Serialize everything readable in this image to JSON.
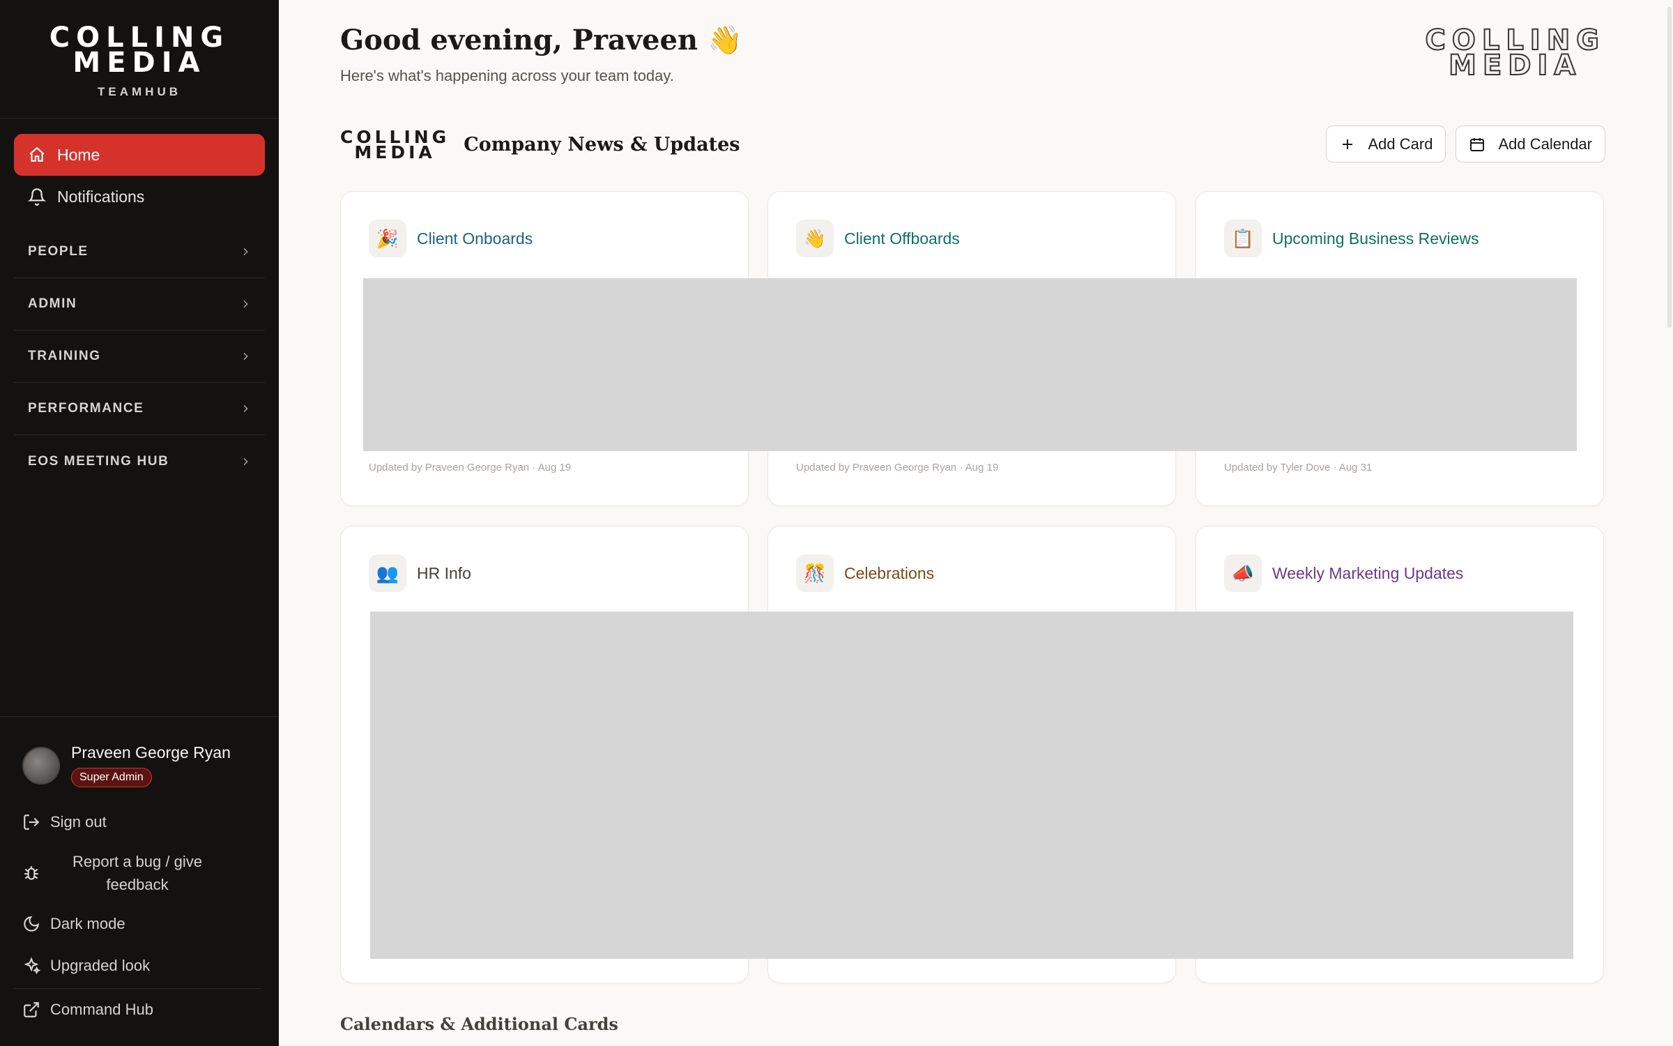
{
  "sidebar": {
    "logo": {
      "line1": "COLLING",
      "line2": "MEDIA",
      "sub": "TEAMHUB"
    },
    "nav": [
      {
        "label": "Home",
        "icon": "home-icon",
        "active": true
      },
      {
        "label": "Notifications",
        "icon": "bell-icon",
        "active": false
      }
    ],
    "sections": [
      "PEOPLE",
      "ADMIN",
      "TRAINING",
      "PERFORMANCE",
      "EOS MEETING HUB"
    ],
    "user": {
      "name": "Praveen George Ryan",
      "role": "Super Admin"
    },
    "bottom": {
      "sign_out": "Sign out",
      "report": "Report a bug / give feedback",
      "dark_mode": "Dark mode",
      "upgraded": "Upgraded look",
      "command_hub": "Command Hub"
    }
  },
  "header": {
    "greeting": "Good evening, Praveen 👋",
    "subtitle": "Here's what's happening across your team today.",
    "logo": {
      "line1": "COLLING",
      "line2": "MEDIA"
    }
  },
  "news": {
    "logo": {
      "line1": "COLLING",
      "line2": "MEDIA"
    },
    "title": "Company News & Updates",
    "add_card": "Add Card",
    "add_calendar": "Add Calendar",
    "cards": [
      {
        "title": "Client Onboards",
        "emoji": "🎉",
        "color": "#1f5f8b",
        "meta": "Updated by Praveen George Ryan · Aug 19"
      },
      {
        "title": "Client Offboards",
        "emoji": "👋",
        "color": "#0f6e6e",
        "meta": "Updated by Praveen George Ryan · Aug 19"
      },
      {
        "title": "Upcoming Business Reviews",
        "emoji": "📋",
        "color": "#0f6e5a",
        "meta": "Updated by Tyler Dove · Aug 31"
      },
      {
        "title": "HR Info",
        "emoji": "👥",
        "color": "#44403c",
        "meta": ""
      },
      {
        "title": "Celebrations",
        "emoji": "🎊",
        "color": "#7a4a12",
        "meta": ""
      },
      {
        "title": "Weekly Marketing Updates",
        "emoji": "📣",
        "color": "#6b3a8a",
        "meta": ""
      }
    ]
  },
  "calendars": {
    "title": "Calendars & Additional Cards"
  },
  "colors": {
    "accent": "#d6322c",
    "sidebar": "#141211",
    "background": "#faf9f7"
  }
}
